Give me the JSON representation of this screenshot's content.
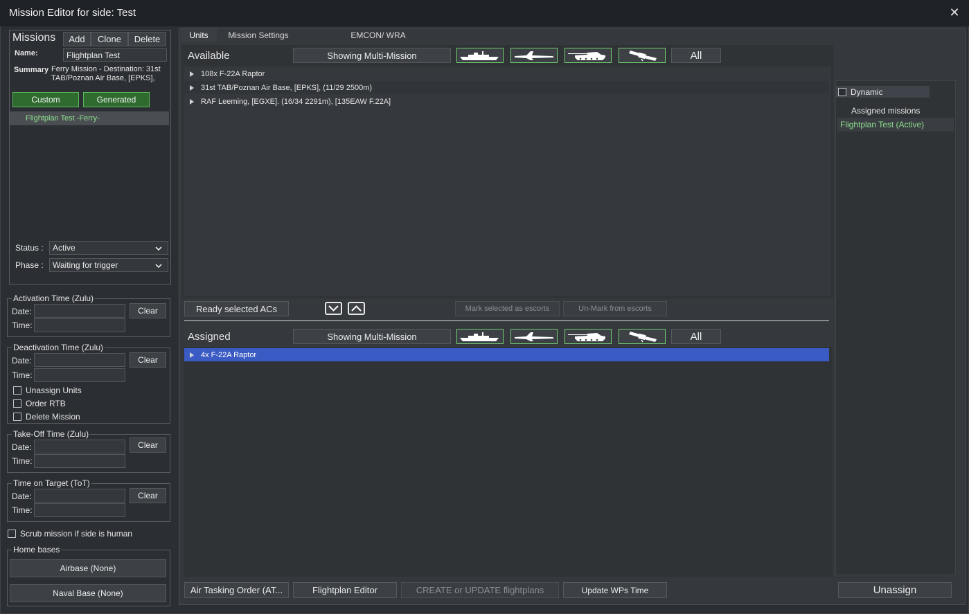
{
  "window": {
    "title": "Mission Editor for side: Test",
    "close": "✕"
  },
  "left": {
    "missions_label": "Missions",
    "add": "Add",
    "clone": "Clone",
    "delete": "Delete",
    "name_label": "Name:",
    "name_value": "Flightplan Test",
    "summary_label": "Summary",
    "summary_line1": "Ferry Mission - Destination: 31st",
    "summary_line2": "TAB/Poznan Air Base, [EPKS],",
    "custom": "Custom",
    "generated": "Generated",
    "mission_items": [
      "Flightplan Test -Ferry-"
    ],
    "status_label": "Status :",
    "status_value": "Active",
    "phase_label": "Phase :",
    "phase_value": "Waiting for trigger",
    "activation": {
      "title": "Activation Time (Zulu)",
      "date": "Date:",
      "time": "Time:",
      "clear": "Clear"
    },
    "deactivation": {
      "title": "Deactivation Time (Zulu)",
      "date": "Date:",
      "time": "Time:",
      "clear": "Clear",
      "opt1": "Unassign Units",
      "opt2": "Order RTB",
      "opt3": "Delete Mission"
    },
    "takeoff": {
      "title": "Take-Off Time (Zulu)",
      "date": "Date:",
      "time": "Time:",
      "clear": "Clear"
    },
    "tot": {
      "title": "Time on Target (ToT)",
      "date": "Date:",
      "time": "Time:",
      "clear": "Clear"
    },
    "scrub": "Scrub mission if side is human",
    "home_bases": {
      "title": "Home bases",
      "airbase": "Airbase (None)",
      "naval": "Naval Base (None)"
    }
  },
  "tabs": [
    "Units",
    "Mission Settings",
    "EMCON/ WRA"
  ],
  "available": {
    "label": "Available",
    "filter": "Showing Multi-Mission",
    "all": "All",
    "rows": [
      "108x F-22A Raptor",
      "31st TAB/Poznan Air Base, [EPKS], (11/29 2500m)",
      "RAF Leeming, [EGXE]. (16/34 2291m), [135EAW F.22A]"
    ]
  },
  "middle": {
    "ready": "Ready selected ACs",
    "mark": "Mark selected as escorts",
    "unmark": "Un-Mark from escorts"
  },
  "assigned": {
    "label": "Assigned",
    "filter": "Showing Multi-Mission",
    "all": "All",
    "rows": [
      "4x F-22A Raptor"
    ]
  },
  "right": {
    "dynamic": "Dynamic",
    "assigned_missions_label": "Assigned missions",
    "assigned_missions": [
      "Flightplan Test (Active)"
    ],
    "unassign": "Unassign"
  },
  "bottom": {
    "ato": "Air Tasking Order (AT...",
    "flightplan_editor": "Flightplan Editor",
    "create_update": "CREATE or UPDATE flightplans",
    "update_wps": "Update WPs Time"
  },
  "colors": {
    "accent_green": "#5cb85c",
    "selection_blue": "#3b5bc4",
    "mission_text": "#8ee08e"
  },
  "icons": [
    "ship-icon",
    "aircraft-icon",
    "tank-icon",
    "satellite-icon",
    "chevron-down-icon",
    "chevron-up-icon",
    "triangle-right-icon",
    "close-icon"
  ]
}
